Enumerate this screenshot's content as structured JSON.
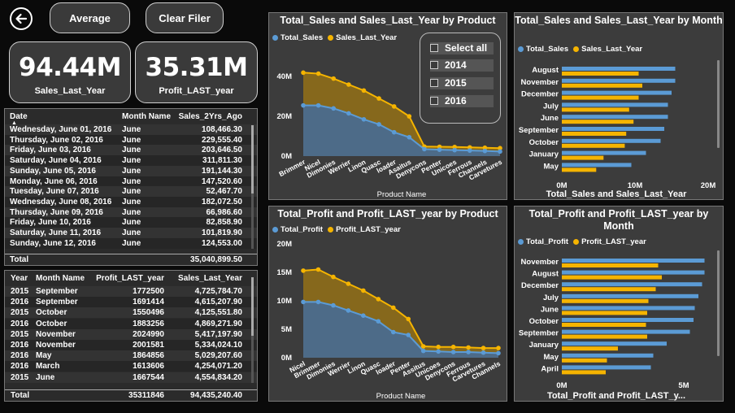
{
  "buttons": {
    "average": "Average",
    "clear_filter": "Clear Filer"
  },
  "kpis": [
    {
      "value": "94.44M",
      "label": "Sales_Last_Year"
    },
    {
      "value": "35.31M",
      "label": "Profit_LAST_year"
    }
  ],
  "colors": {
    "total": "#5b9bd5",
    "last": "#f5b400",
    "total_fill": "#4a6b8e",
    "last_fill": "#8a6a1a"
  },
  "table1": {
    "headers": [
      "Date",
      "Month Name",
      "Sales_2Yrs_Ago"
    ],
    "rows": [
      [
        "Wednesday, June 01, 2016",
        "June",
        "108,466.30"
      ],
      [
        "Thursday, June 02, 2016",
        "June",
        "229,555.40"
      ],
      [
        "Friday, June 03, 2016",
        "June",
        "203,646.50"
      ],
      [
        "Saturday, June 04, 2016",
        "June",
        "311,811.30"
      ],
      [
        "Sunday, June 05, 2016",
        "June",
        "191,144.30"
      ],
      [
        "Monday, June 06, 2016",
        "June",
        "147,520.60"
      ],
      [
        "Tuesday, June 07, 2016",
        "June",
        "52,467.70"
      ],
      [
        "Wednesday, June 08, 2016",
        "June",
        "182,072.50"
      ],
      [
        "Thursday, June 09, 2016",
        "June",
        "66,986.60"
      ],
      [
        "Friday, June 10, 2016",
        "June",
        "82,858.90"
      ],
      [
        "Saturday, June 11, 2016",
        "June",
        "101,819.90"
      ],
      [
        "Sunday, June 12, 2016",
        "June",
        "124,553.00"
      ]
    ],
    "total": [
      "Total",
      "",
      "35,040,899.50"
    ]
  },
  "table2": {
    "headers": [
      "Year",
      "Month Name",
      "Profit_LAST_year",
      "Sales_Last_Year"
    ],
    "rows": [
      [
        "2015",
        "September",
        "1772500",
        "4,725,784.70"
      ],
      [
        "2016",
        "September",
        "1691414",
        "4,615,207.90"
      ],
      [
        "2015",
        "October",
        "1550496",
        "4,125,551.80"
      ],
      [
        "2016",
        "October",
        "1883256",
        "4,869,271.90"
      ],
      [
        "2015",
        "November",
        "2024990",
        "5,417,197.90"
      ],
      [
        "2016",
        "November",
        "2001581",
        "5,334,024.10"
      ],
      [
        "2016",
        "May",
        "1864856",
        "5,029,207.60"
      ],
      [
        "2016",
        "March",
        "1613606",
        "4,254,071.20"
      ],
      [
        "2015",
        "June",
        "1667544",
        "4,554,834.20"
      ]
    ],
    "total": [
      "Total",
      "",
      "35311846",
      "94,435,240.40"
    ]
  },
  "slicer": {
    "items": [
      "Select all",
      "2014",
      "2015",
      "2016"
    ]
  },
  "chart_data": [
    {
      "type": "area",
      "title": "Total_Sales and Sales_Last_Year by Product",
      "xlabel": "Product Name",
      "ylabel": "",
      "ylim": [
        0,
        45
      ],
      "yticks": [
        "0M",
        "20M",
        "40M"
      ],
      "ytick_values": [
        0,
        20,
        40
      ],
      "categories": [
        "Brimmer",
        "Nicel",
        "Dimonies",
        "Werrier",
        "Linon",
        "Quasc",
        "loader",
        "Asaitus",
        "Denycons",
        "Penter",
        "Unicoes",
        "Ferrous",
        "Channels",
        "Carvetures"
      ],
      "series": [
        {
          "name": "Total_Sales",
          "values": [
            25.5,
            25.5,
            24,
            21.5,
            18.5,
            16,
            12,
            9.5,
            3.5,
            3.2,
            3.0,
            2.8,
            2.6,
            2.3
          ]
        },
        {
          "name": "Sales_Last_Year",
          "values": [
            42,
            41.5,
            39,
            36,
            33,
            29,
            25,
            20,
            4.8,
            4.7,
            4.6,
            4.4,
            4.2,
            4.0
          ]
        }
      ],
      "legend": "top-left"
    },
    {
      "type": "bar",
      "orientation": "horizontal",
      "title": "Total_Sales and Sales_Last_Year by Month",
      "xlabel": "Total_Sales and Sales_Last_Year",
      "xlim": [
        0,
        20
      ],
      "xticks": [
        "0M",
        "10M",
        "20M"
      ],
      "xtick_values": [
        0,
        10,
        20
      ],
      "categories": [
        "August",
        "November",
        "December",
        "July",
        "June",
        "September",
        "October",
        "January",
        "May"
      ],
      "series": [
        {
          "name": "Total_Sales",
          "values": [
            15.5,
            15.5,
            15,
            14.5,
            14.5,
            14,
            13.5,
            11.5,
            9.5
          ]
        },
        {
          "name": "Sales_Last_Year",
          "values": [
            10.5,
            11,
            10.5,
            9.2,
            9.8,
            8.8,
            8.6,
            5.7,
            4.7
          ]
        }
      ],
      "legend": "top-left"
    },
    {
      "type": "area",
      "title": "Total_Profit and Profit_LAST_year by Product",
      "xlabel": "Product Name",
      "ylabel": "",
      "ylim": [
        0,
        20
      ],
      "yticks": [
        "0M",
        "5M",
        "10M",
        "15M",
        "20M"
      ],
      "ytick_values": [
        0,
        5,
        10,
        15,
        20
      ],
      "categories": [
        "Nicel",
        "Brimmer",
        "Dimonies",
        "Werrier",
        "Linon",
        "Quasc",
        "loader",
        "Penter",
        "Assitus",
        "Unicoes",
        "Denycons",
        "Ferrous",
        "Carvetures",
        "Channels"
      ],
      "series": [
        {
          "name": "Total_Profit",
          "values": [
            9.8,
            9.8,
            9.2,
            8.3,
            7.4,
            6.4,
            4.5,
            4.0,
            1.2,
            1.1,
            1.0,
            1.0,
            0.9,
            0.8
          ]
        },
        {
          "name": "Profit_LAST_year",
          "values": [
            15.3,
            15.5,
            14.2,
            13.0,
            11.8,
            10.3,
            8.8,
            6.8,
            2.0,
            1.9,
            1.9,
            1.8,
            1.7,
            1.7
          ]
        }
      ],
      "legend": "top-left"
    },
    {
      "type": "bar",
      "orientation": "horizontal",
      "title": "Total_Profit and Profit_LAST_year by Month",
      "xlabel": "Total_Profit and Profit_LAST_y...",
      "xlim": [
        0,
        6.2
      ],
      "xticks": [
        "0M",
        "5M"
      ],
      "xtick_values": [
        0,
        5
      ],
      "categories": [
        "November",
        "August",
        "December",
        "July",
        "June",
        "October",
        "September",
        "January",
        "May",
        "April"
      ],
      "series": [
        {
          "name": "Total_Profit",
          "values": [
            5.85,
            5.85,
            5.75,
            5.6,
            5.45,
            5.4,
            5.25,
            4.3,
            3.75,
            3.65
          ]
        },
        {
          "name": "Profit_LAST_year",
          "values": [
            3.95,
            4.1,
            3.85,
            3.55,
            3.5,
            3.45,
            3.5,
            2.3,
            1.85,
            1.8
          ]
        }
      ],
      "legend": "top-left"
    }
  ]
}
